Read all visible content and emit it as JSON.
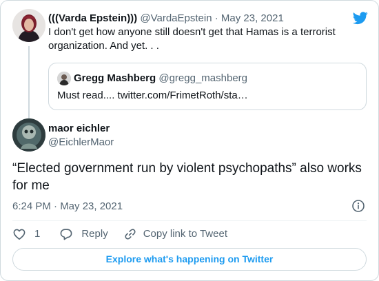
{
  "brand": {
    "accent": "#1d9bf0",
    "text": "#0f1419",
    "muted": "#536471",
    "border": "#cfd9de",
    "logo_icon": "twitter-bird-icon"
  },
  "parent_tweet": {
    "author_name": "(((Varda Epstein)))",
    "author_handle": "@VardaEpstein",
    "separator": "·",
    "date": "May 23, 2021",
    "text": "I don't get how anyone still doesn't get that Hamas is a terrorist organization. And yet. . .",
    "quoted_tweet": {
      "author_name": "Gregg Mashberg",
      "author_handle": "@gregg_mashberg",
      "text": "Must read.... twitter.com/FrimetRoth/sta…"
    }
  },
  "tweet": {
    "author_name": "maor eichler",
    "author_handle": "@EichlerMaor",
    "text": "“Elected government run by violent psychopaths” also works for me",
    "timestamp": "6:24 PM · May 23, 2021",
    "info_icon": "info-icon"
  },
  "actions": {
    "like_count": "1",
    "like_icon": "heart-icon",
    "reply_label": "Reply",
    "reply_icon": "speech-bubble-icon",
    "copy_label": "Copy link to Tweet",
    "copy_icon": "link-icon"
  },
  "footer": {
    "explore_label": "Explore what's happening on Twitter"
  }
}
